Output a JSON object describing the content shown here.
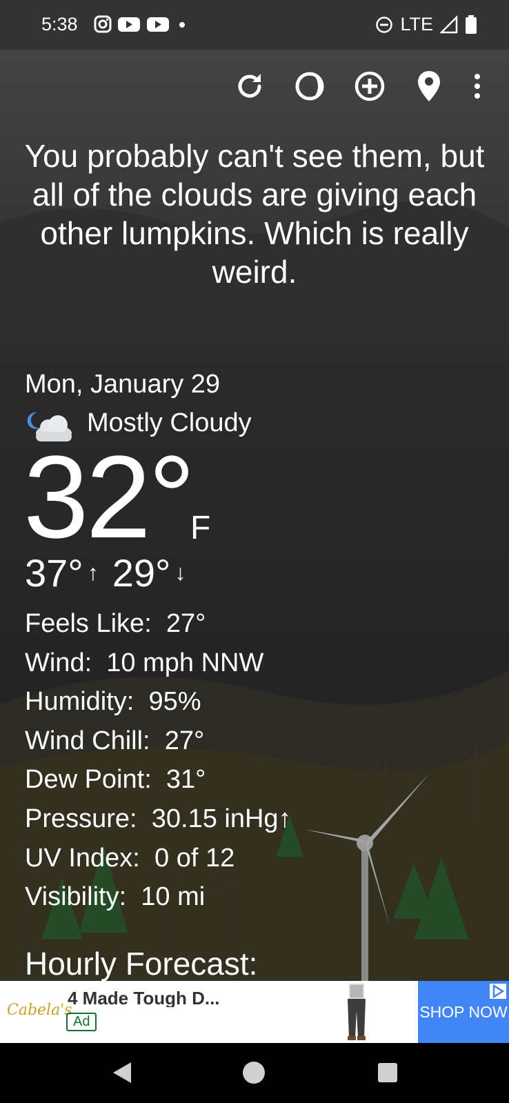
{
  "status_bar": {
    "time": "5:38",
    "network": "LTE",
    "icons": [
      "instagram-icon",
      "youtube-icon",
      "youtube-icon",
      "dot-icon",
      "dnd-icon",
      "signal-icon",
      "battery-icon"
    ]
  },
  "toolbar": {
    "icons": [
      "refresh-icon",
      "moon-phase-icon",
      "add-location-icon",
      "location-pin-icon",
      "more-vert-icon"
    ]
  },
  "quote": "You probably can't see them, but all of the clouds are giving each other lumpkins. Which is really weird.",
  "weather": {
    "date": "Mon, January 29",
    "condition": "Mostly Cloudy",
    "temperature": "32°",
    "unit": "F",
    "high": "37°",
    "high_arrow": "↑",
    "low": "29°",
    "low_arrow": "↓"
  },
  "details": [
    {
      "label": "Feels Like:",
      "value": "27°"
    },
    {
      "label": "Wind:",
      "value": "10 mph NNW"
    },
    {
      "label": "Humidity:",
      "value": "95%"
    },
    {
      "label": "Wind Chill:",
      "value": "27°"
    },
    {
      "label": "Dew Point:",
      "value": "31°"
    },
    {
      "label": "Pressure:",
      "value": "30.15 inHg↑"
    },
    {
      "label": "UV Index:",
      "value": "0 of 12"
    },
    {
      "label": "Visibility:",
      "value": "10 mi"
    }
  ],
  "hourly_title": "Hourly Forecast:",
  "ad": {
    "brand": "Cabela's",
    "title": "4 Made Tough D...",
    "badge": "Ad",
    "cta": "SHOP NOW"
  },
  "colors": {
    "status_bar": "#333333",
    "background": "#222222",
    "ad_cta": "#4285f4",
    "ad_badge": "#1a6b36"
  }
}
